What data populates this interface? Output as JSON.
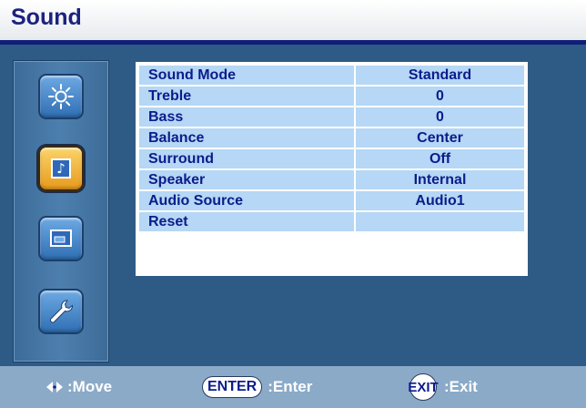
{
  "header": {
    "title": "Sound"
  },
  "sidebar": {
    "items": [
      {
        "icon": "brightness-icon",
        "active": false
      },
      {
        "icon": "music-note-icon",
        "active": true,
        "glyph": "♪"
      },
      {
        "icon": "screen-icon",
        "active": false
      },
      {
        "icon": "wrench-icon",
        "active": false
      }
    ]
  },
  "menu": {
    "rows": [
      {
        "label": "Sound Mode",
        "value": "Standard"
      },
      {
        "label": "Treble",
        "value": "0"
      },
      {
        "label": "Bass",
        "value": "0"
      },
      {
        "label": "Balance",
        "value": "Center"
      },
      {
        "label": "Surround",
        "value": "Off"
      },
      {
        "label": "Speaker",
        "value": "Internal"
      },
      {
        "label": "Audio Source",
        "value": "Audio1"
      },
      {
        "label": "Reset",
        "value": ""
      }
    ]
  },
  "footer": {
    "move_label": ":Move",
    "enter_key": "ENTER",
    "enter_label": ":Enter",
    "exit_key": "EXIT",
    "exit_label": ":Exit"
  },
  "colors": {
    "background": "#2e5b85",
    "header_title": "#1a237e",
    "cell_bg": "#b6d7f5",
    "cell_text": "#0b1c8c",
    "active_button": "#f2b53a"
  }
}
